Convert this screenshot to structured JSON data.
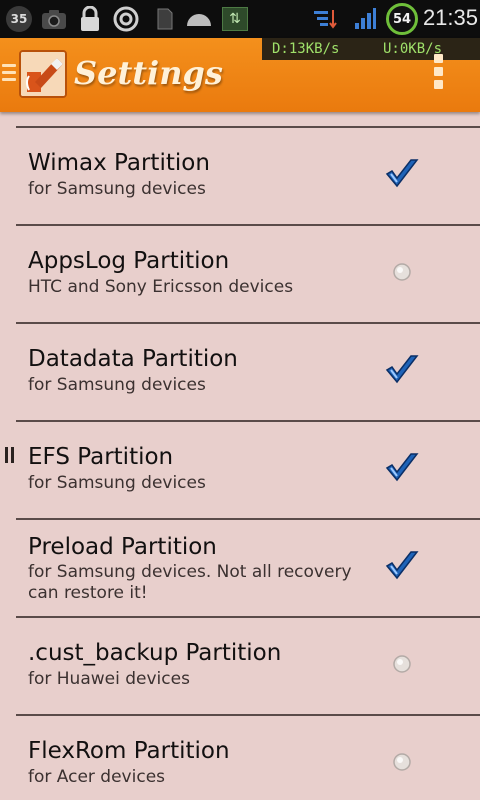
{
  "status_bar": {
    "notification_count": "35",
    "battery_level": "54",
    "time": "21:35",
    "icons": [
      "notification-count-icon",
      "camera-icon",
      "lock-icon",
      "target-icon",
      "sd-card-icon",
      "dome-icon",
      "data-transfer-icon",
      "wifi-icon",
      "signal-icon",
      "battery-icon"
    ]
  },
  "action_bar": {
    "download_speed": "D:13KB/s",
    "upload_speed": "U:0KB/s",
    "title": "Settings",
    "accent_color": "#f08a18"
  },
  "list": {
    "items": [
      {
        "title": "Wimax Partition",
        "subtitle": "for Samsung devices",
        "checked": true
      },
      {
        "title": "AppsLog Partition",
        "subtitle": "HTC and Sony Ericsson devices",
        "checked": false
      },
      {
        "title": "Datadata Partition",
        "subtitle": "for Samsung devices",
        "checked": true
      },
      {
        "title": "EFS Partition",
        "subtitle": "for Samsung devices",
        "checked": true
      },
      {
        "title": "Preload Partition",
        "subtitle": "for Samsung devices. Not all recovery can restore it!",
        "checked": true
      },
      {
        "title": ".cust_backup Partition",
        "subtitle": "for Huawei devices",
        "checked": false
      },
      {
        "title": "FlexRom Partition",
        "subtitle": "for Acer devices",
        "checked": false
      }
    ]
  }
}
